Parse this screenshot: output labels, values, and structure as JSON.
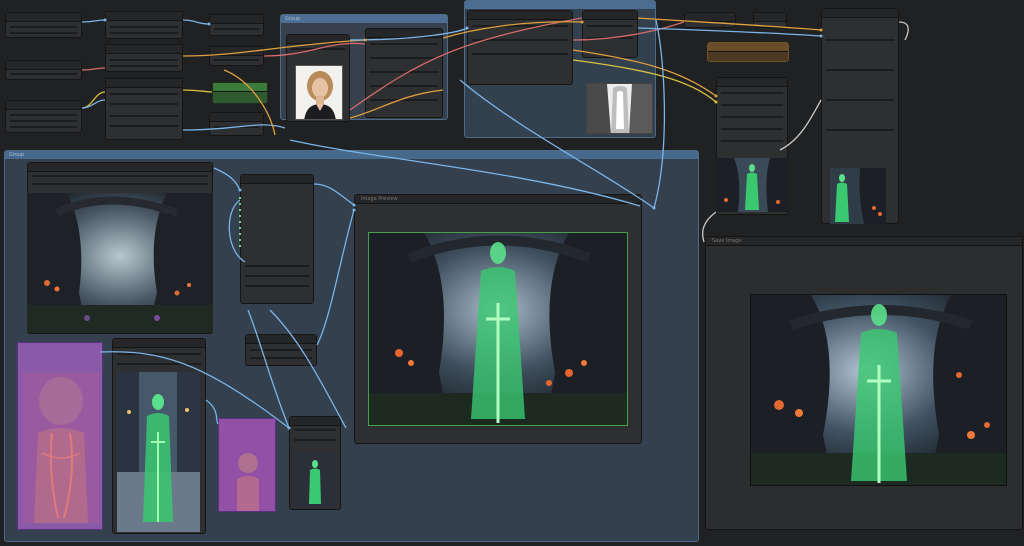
{
  "groups": {
    "top_center": {
      "title": "Group"
    },
    "top_right": {
      "title": ""
    },
    "bottom_main": {
      "title": "Group"
    }
  },
  "nodes": {
    "preview_large": {
      "title": "Image Preview"
    },
    "save_image": {
      "title": "Save Image"
    }
  },
  "colors": {
    "canvas": "#202122",
    "group_blue": "#3a4a5c",
    "node_body": "#2e2f31",
    "wire_blue": "#7ab4e8",
    "wire_orange": "#e0a040",
    "wire_red": "#d46a6a",
    "wire_green": "#78c878",
    "wire_yellow": "#d8c040",
    "accent_green": "#3a8a3a"
  },
  "images": {
    "portrait": "woman-portrait",
    "depth_map": "depth-map",
    "forest": "dark-forest",
    "green_woman": "green-glowing-woman-with-sword"
  }
}
